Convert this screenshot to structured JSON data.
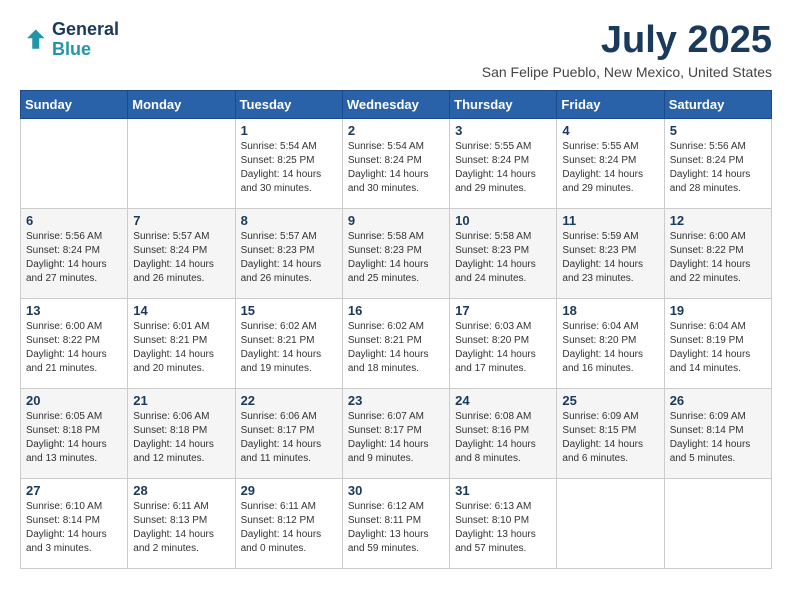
{
  "logo": {
    "line1": "General",
    "line2": "Blue"
  },
  "title": "July 2025",
  "location": "San Felipe Pueblo, New Mexico, United States",
  "days_of_week": [
    "Sunday",
    "Monday",
    "Tuesday",
    "Wednesday",
    "Thursday",
    "Friday",
    "Saturday"
  ],
  "weeks": [
    [
      {
        "day": "",
        "info": ""
      },
      {
        "day": "",
        "info": ""
      },
      {
        "day": "1",
        "info": "Sunrise: 5:54 AM\nSunset: 8:25 PM\nDaylight: 14 hours\nand 30 minutes."
      },
      {
        "day": "2",
        "info": "Sunrise: 5:54 AM\nSunset: 8:24 PM\nDaylight: 14 hours\nand 30 minutes."
      },
      {
        "day": "3",
        "info": "Sunrise: 5:55 AM\nSunset: 8:24 PM\nDaylight: 14 hours\nand 29 minutes."
      },
      {
        "day": "4",
        "info": "Sunrise: 5:55 AM\nSunset: 8:24 PM\nDaylight: 14 hours\nand 29 minutes."
      },
      {
        "day": "5",
        "info": "Sunrise: 5:56 AM\nSunset: 8:24 PM\nDaylight: 14 hours\nand 28 minutes."
      }
    ],
    [
      {
        "day": "6",
        "info": "Sunrise: 5:56 AM\nSunset: 8:24 PM\nDaylight: 14 hours\nand 27 minutes."
      },
      {
        "day": "7",
        "info": "Sunrise: 5:57 AM\nSunset: 8:24 PM\nDaylight: 14 hours\nand 26 minutes."
      },
      {
        "day": "8",
        "info": "Sunrise: 5:57 AM\nSunset: 8:23 PM\nDaylight: 14 hours\nand 26 minutes."
      },
      {
        "day": "9",
        "info": "Sunrise: 5:58 AM\nSunset: 8:23 PM\nDaylight: 14 hours\nand 25 minutes."
      },
      {
        "day": "10",
        "info": "Sunrise: 5:58 AM\nSunset: 8:23 PM\nDaylight: 14 hours\nand 24 minutes."
      },
      {
        "day": "11",
        "info": "Sunrise: 5:59 AM\nSunset: 8:23 PM\nDaylight: 14 hours\nand 23 minutes."
      },
      {
        "day": "12",
        "info": "Sunrise: 6:00 AM\nSunset: 8:22 PM\nDaylight: 14 hours\nand 22 minutes."
      }
    ],
    [
      {
        "day": "13",
        "info": "Sunrise: 6:00 AM\nSunset: 8:22 PM\nDaylight: 14 hours\nand 21 minutes."
      },
      {
        "day": "14",
        "info": "Sunrise: 6:01 AM\nSunset: 8:21 PM\nDaylight: 14 hours\nand 20 minutes."
      },
      {
        "day": "15",
        "info": "Sunrise: 6:02 AM\nSunset: 8:21 PM\nDaylight: 14 hours\nand 19 minutes."
      },
      {
        "day": "16",
        "info": "Sunrise: 6:02 AM\nSunset: 8:21 PM\nDaylight: 14 hours\nand 18 minutes."
      },
      {
        "day": "17",
        "info": "Sunrise: 6:03 AM\nSunset: 8:20 PM\nDaylight: 14 hours\nand 17 minutes."
      },
      {
        "day": "18",
        "info": "Sunrise: 6:04 AM\nSunset: 8:20 PM\nDaylight: 14 hours\nand 16 minutes."
      },
      {
        "day": "19",
        "info": "Sunrise: 6:04 AM\nSunset: 8:19 PM\nDaylight: 14 hours\nand 14 minutes."
      }
    ],
    [
      {
        "day": "20",
        "info": "Sunrise: 6:05 AM\nSunset: 8:18 PM\nDaylight: 14 hours\nand 13 minutes."
      },
      {
        "day": "21",
        "info": "Sunrise: 6:06 AM\nSunset: 8:18 PM\nDaylight: 14 hours\nand 12 minutes."
      },
      {
        "day": "22",
        "info": "Sunrise: 6:06 AM\nSunset: 8:17 PM\nDaylight: 14 hours\nand 11 minutes."
      },
      {
        "day": "23",
        "info": "Sunrise: 6:07 AM\nSunset: 8:17 PM\nDaylight: 14 hours\nand 9 minutes."
      },
      {
        "day": "24",
        "info": "Sunrise: 6:08 AM\nSunset: 8:16 PM\nDaylight: 14 hours\nand 8 minutes."
      },
      {
        "day": "25",
        "info": "Sunrise: 6:09 AM\nSunset: 8:15 PM\nDaylight: 14 hours\nand 6 minutes."
      },
      {
        "day": "26",
        "info": "Sunrise: 6:09 AM\nSunset: 8:14 PM\nDaylight: 14 hours\nand 5 minutes."
      }
    ],
    [
      {
        "day": "27",
        "info": "Sunrise: 6:10 AM\nSunset: 8:14 PM\nDaylight: 14 hours\nand 3 minutes."
      },
      {
        "day": "28",
        "info": "Sunrise: 6:11 AM\nSunset: 8:13 PM\nDaylight: 14 hours\nand 2 minutes."
      },
      {
        "day": "29",
        "info": "Sunrise: 6:11 AM\nSunset: 8:12 PM\nDaylight: 14 hours\nand 0 minutes."
      },
      {
        "day": "30",
        "info": "Sunrise: 6:12 AM\nSunset: 8:11 PM\nDaylight: 13 hours\nand 59 minutes."
      },
      {
        "day": "31",
        "info": "Sunrise: 6:13 AM\nSunset: 8:10 PM\nDaylight: 13 hours\nand 57 minutes."
      },
      {
        "day": "",
        "info": ""
      },
      {
        "day": "",
        "info": ""
      }
    ]
  ]
}
